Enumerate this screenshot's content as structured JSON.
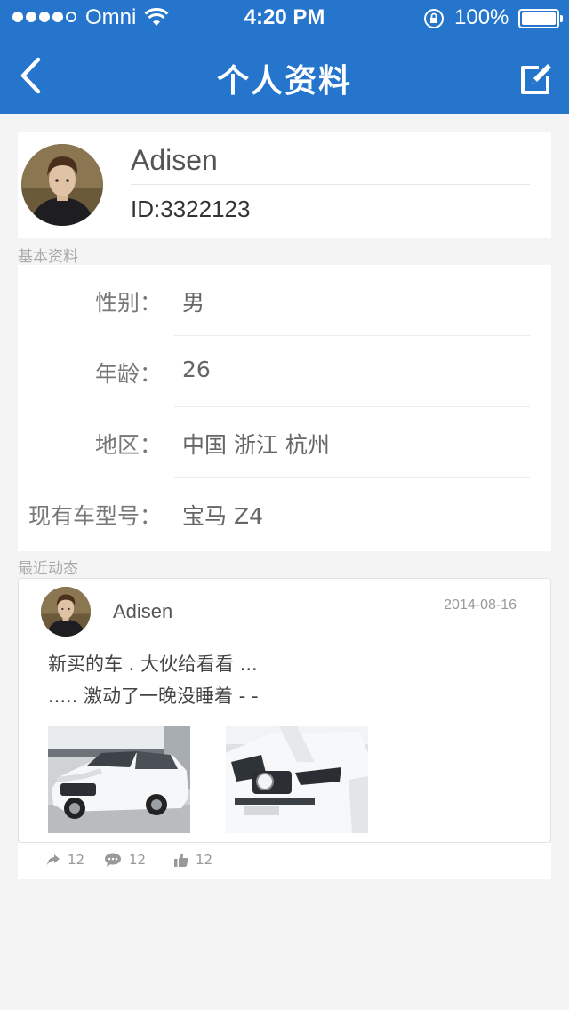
{
  "status_bar": {
    "carrier": "Omni",
    "time": "4:20 PM",
    "battery": "100%"
  },
  "header": {
    "title": "个人资料",
    "back_icon": "chevron-left-icon",
    "edit_icon": "edit-icon"
  },
  "profile": {
    "name": "Adisen",
    "id": "ID:3322123"
  },
  "basic_info": {
    "section_title": "基本资料",
    "rows": [
      {
        "label": "性别：",
        "value": "男"
      },
      {
        "label": "年龄：",
        "value": "26"
      },
      {
        "label": "地区：",
        "value": "中国 浙江 杭州"
      },
      {
        "label": "现有车型号：",
        "value": "宝马 Z4"
      }
    ]
  },
  "recent": {
    "section_title": "最近动态",
    "post": {
      "author": "Adisen",
      "date": "2014-08-16",
      "text_line1": "新买的车 . 大伙给看看 ...",
      "text_line2": "..... 激动了一晚没睡着 - -",
      "share_count": "12",
      "comment_count": "12",
      "like_count": "12"
    }
  },
  "colors": {
    "accent": "#2575cc",
    "background": "#f4f4f4"
  }
}
